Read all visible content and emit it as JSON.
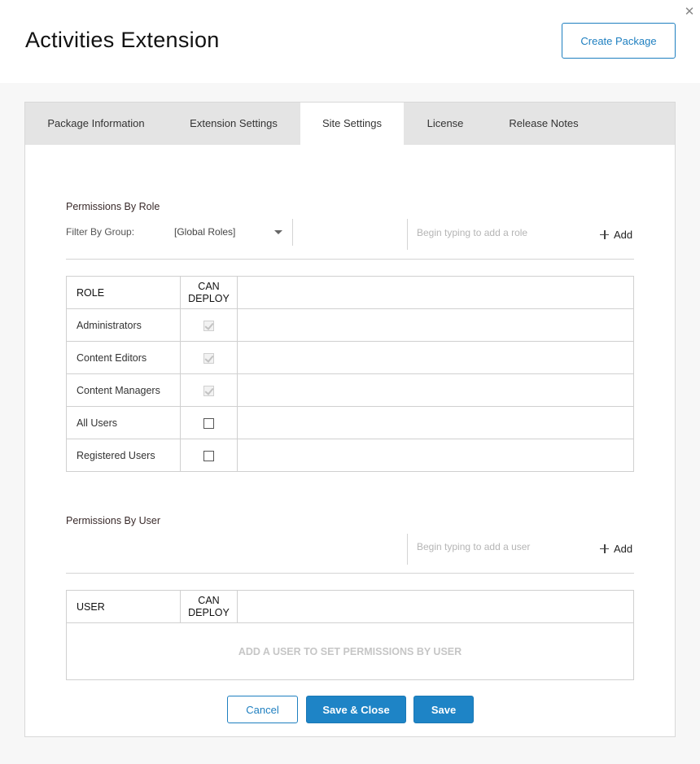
{
  "header": {
    "title": "Activities Extension",
    "create_package_label": "Create Package",
    "close_glyph": "✕"
  },
  "tabs": [
    {
      "label": "Package Information",
      "active": false
    },
    {
      "label": "Extension Settings",
      "active": false
    },
    {
      "label": "Site Settings",
      "active": true
    },
    {
      "label": "License",
      "active": false
    },
    {
      "label": "Release Notes",
      "active": false
    }
  ],
  "roles_section": {
    "title": "Permissions By Role",
    "filter_label": "Filter By Group:",
    "filter_value": "[Global Roles]",
    "add_placeholder": "Begin typing to add a role",
    "add_label": "Add",
    "col_role": "ROLE",
    "col_deploy_line1": "CAN",
    "col_deploy_line2": "DEPLOY",
    "rows": [
      {
        "name": "Administrators",
        "can_deploy": true,
        "disabled": true
      },
      {
        "name": "Content Editors",
        "can_deploy": true,
        "disabled": true
      },
      {
        "name": "Content Managers",
        "can_deploy": true,
        "disabled": true
      },
      {
        "name": "All Users",
        "can_deploy": false,
        "disabled": false
      },
      {
        "name": "Registered Users",
        "can_deploy": false,
        "disabled": false
      }
    ]
  },
  "users_section": {
    "title": "Permissions By User",
    "add_placeholder": "Begin typing to add a user",
    "add_label": "Add",
    "col_user": "USER",
    "col_deploy_line1": "CAN",
    "col_deploy_line2": "DEPLOY",
    "empty_message": "ADD A USER TO SET PERMISSIONS BY USER"
  },
  "footer": {
    "cancel_label": "Cancel",
    "save_close_label": "Save & Close",
    "save_label": "Save"
  },
  "colors": {
    "accent": "#1e84c6",
    "tabbar_bg": "#e4e4e4"
  }
}
